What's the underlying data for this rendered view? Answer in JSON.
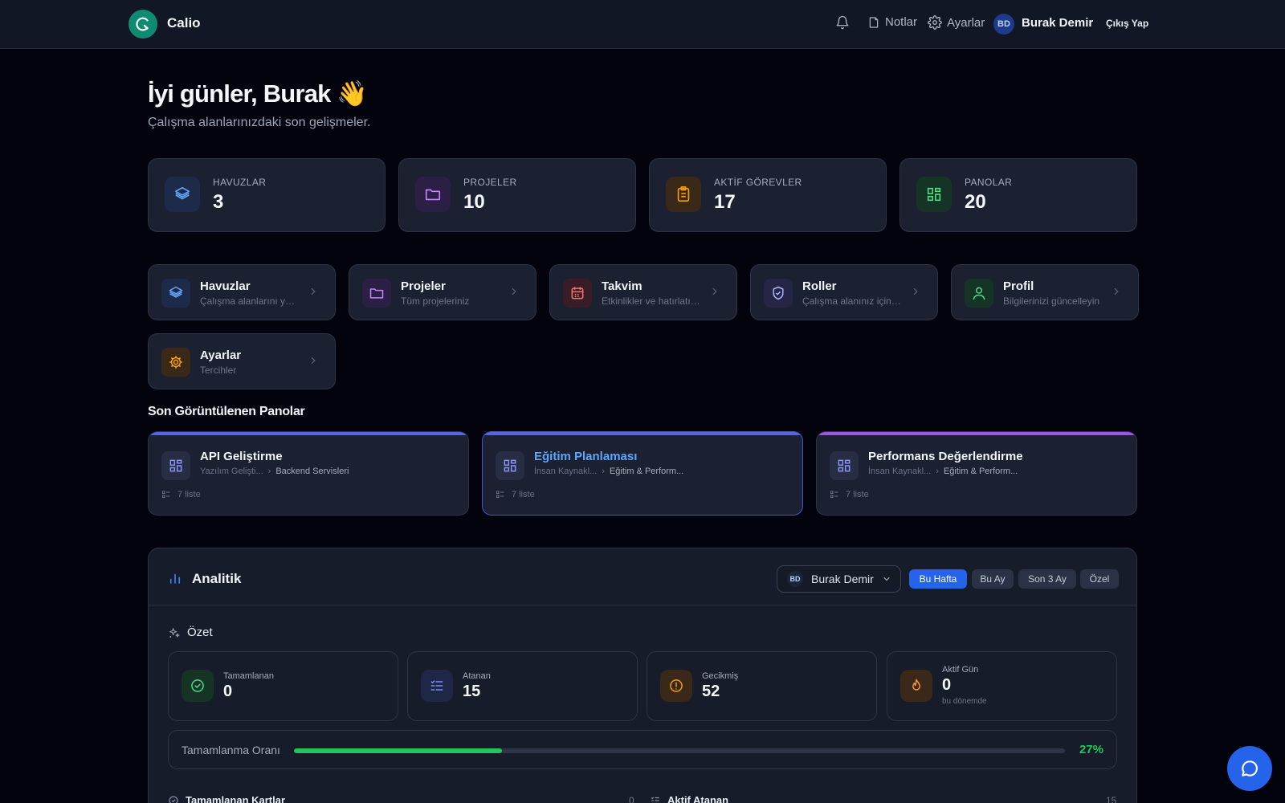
{
  "header": {
    "brand": "Calio",
    "notes_label": "Notlar",
    "settings_label": "Ayarlar",
    "user_initials": "BD",
    "user_name": "Burak Demir",
    "logout_label": "Çıkış Yap"
  },
  "greeting": {
    "title": "İyi günler, Burak 👋",
    "subtitle": "Çalışma alanlarınızdaki son gelişmeler."
  },
  "stats": [
    {
      "label": "HAVUZLAR",
      "value": "3",
      "icon": "layers-icon",
      "color": "#3b82f6"
    },
    {
      "label": "PROJELER",
      "value": "10",
      "icon": "folder-icon",
      "color": "#a855f7"
    },
    {
      "label": "AKTİF GÖREVLER",
      "value": "17",
      "icon": "clipboard-icon",
      "color": "#f59e0b"
    },
    {
      "label": "PANOLAR",
      "value": "20",
      "icon": "grid-icon",
      "color": "#22c55e"
    }
  ],
  "nav_cards": [
    {
      "title": "Havuzlar",
      "subtitle": "Çalışma alanlarını yönetin",
      "icon": "layers-icon"
    },
    {
      "title": "Projeler",
      "subtitle": "Tüm projeleriniz",
      "icon": "folder-icon"
    },
    {
      "title": "Takvim",
      "subtitle": "Etkinlikler ve hatırlatıcılar",
      "icon": "calendar-icon"
    },
    {
      "title": "Roller",
      "subtitle": "Çalışma alanınız için roller",
      "icon": "shield-icon"
    },
    {
      "title": "Profil",
      "subtitle": "Bilgilerinizi güncelleyin",
      "icon": "user-icon"
    },
    {
      "title": "Ayarlar",
      "subtitle": "Tercihler",
      "icon": "gear-icon"
    }
  ],
  "recent_boards": {
    "title": "Son Görüntülenen Panolar",
    "items": [
      {
        "title": "API Geliştirme",
        "workspace": "Yazılım Gelişti...",
        "project": "Backend Servisleri",
        "lists": "7 liste"
      },
      {
        "title": "Eğitim Planlaması",
        "workspace": "İnsan Kaynakl...",
        "project": "Eğitim & Perform...",
        "lists": "7 liste"
      },
      {
        "title": "Performans Değerlendirme",
        "workspace": "İnsan Kaynakl...",
        "project": "Eğitim & Perform...",
        "lists": "7 liste"
      }
    ]
  },
  "analytics": {
    "title": "Analitik",
    "user_initials": "BD",
    "user_select": "Burak Demir",
    "ranges": [
      "Bu Hafta",
      "Bu Ay",
      "Son 3 Ay",
      "Özel"
    ],
    "active_range": "Bu Hafta",
    "summary_title": "Özet",
    "summary": [
      {
        "label": "Tamamlanan",
        "value": "0",
        "icon": "check-circle-icon"
      },
      {
        "label": "Atanan",
        "value": "15",
        "icon": "list-check-icon"
      },
      {
        "label": "Gecikmiş",
        "value": "52",
        "icon": "alert-circle-icon"
      },
      {
        "label": "Aktif Gün",
        "value": "0",
        "sub": "bu dönemde",
        "icon": "flame-icon"
      }
    ],
    "completion": {
      "label": "Tamamlanma Oranı",
      "value_text": "27%",
      "percent": 27
    },
    "lower_left": {
      "title": "Tamamlanan Kartlar",
      "count": "0"
    },
    "lower_right": {
      "title": "Aktif Atanan",
      "count": "15"
    }
  }
}
